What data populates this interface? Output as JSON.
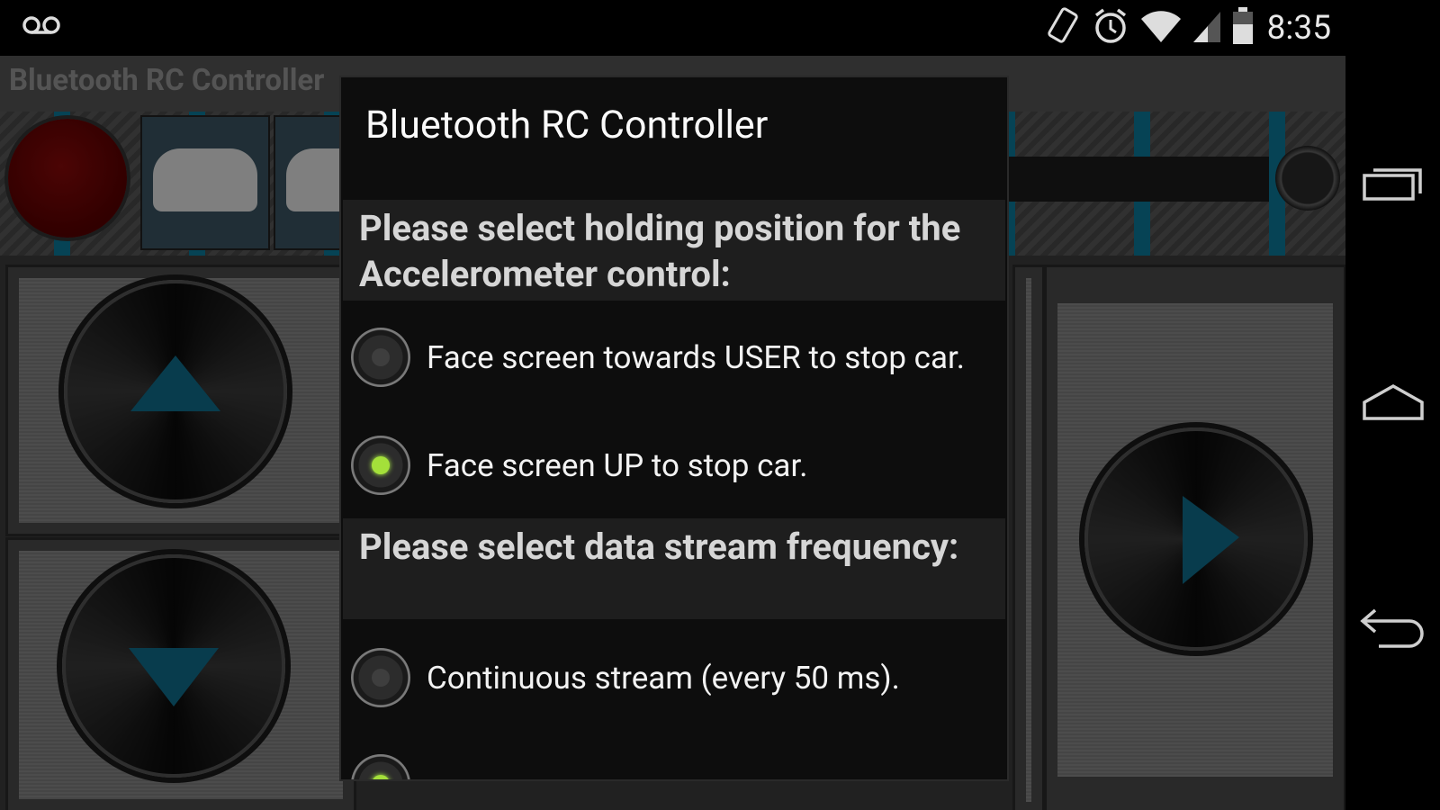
{
  "status_bar": {
    "time": "8:35",
    "icons": [
      "voicemail-icon",
      "rotation-icon",
      "alarm-icon",
      "wifi-icon",
      "signal-icon",
      "battery-icon"
    ]
  },
  "app": {
    "title": "Bluetooth RC Controller"
  },
  "dialog": {
    "title": "Bluetooth RC Controller",
    "sections": [
      {
        "heading": "Please select holding position for the Accelerometer control:",
        "options": [
          {
            "label": "Face screen towards USER to stop car.",
            "checked": false
          },
          {
            "label": "Face screen UP to stop car.",
            "checked": true
          }
        ]
      },
      {
        "heading": "Please select data stream frequency:",
        "options": [
          {
            "label": "Continuous stream (every 50 ms).",
            "checked": false
          },
          {
            "label": "",
            "checked": true
          }
        ]
      }
    ]
  },
  "colors": {
    "accent_blue": "#0b7a9c",
    "radio_checked": "#a4e03a",
    "record_red": "#7a0a0a"
  },
  "nav": {
    "icons": [
      "recent-apps-icon",
      "home-icon",
      "back-icon"
    ]
  }
}
